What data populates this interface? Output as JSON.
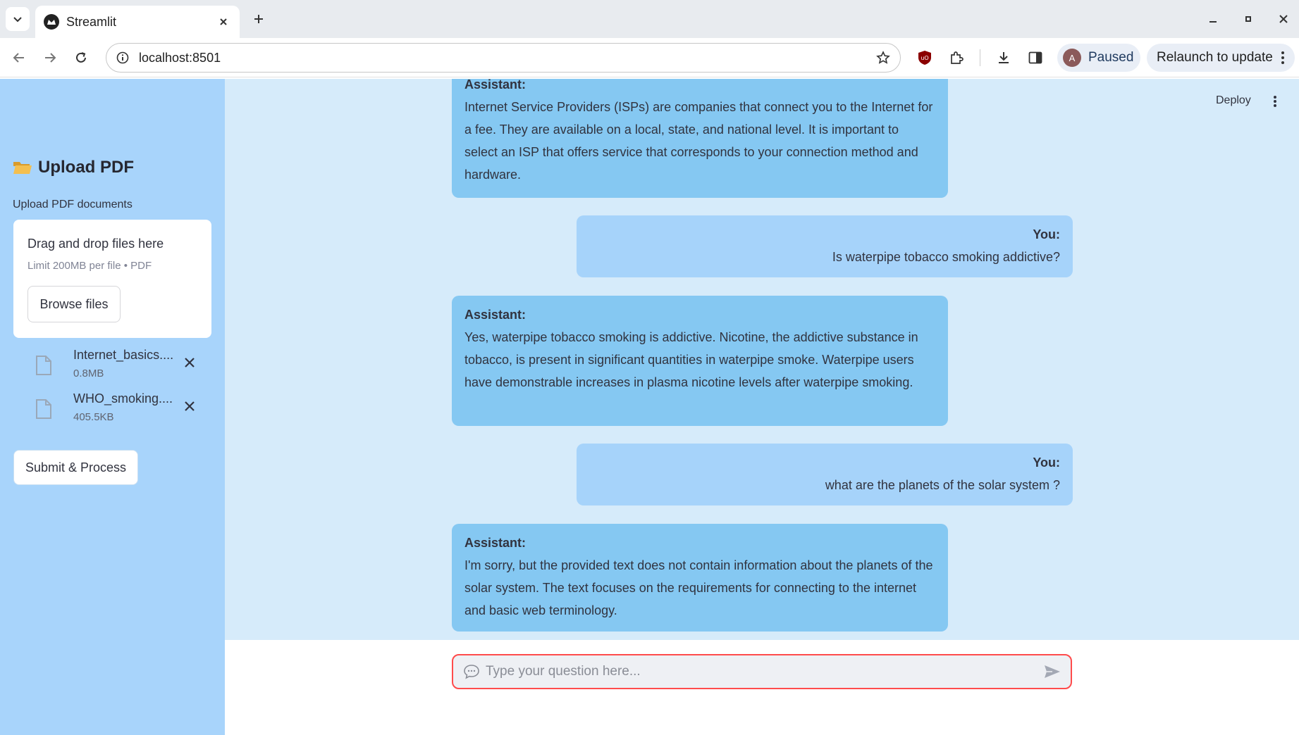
{
  "browser": {
    "tab_title": "Streamlit",
    "url": "localhost:8501",
    "profile_initial": "A",
    "profile_status": "Paused",
    "relaunch_label": "Relaunch to update"
  },
  "sidebar": {
    "title": "Upload PDF",
    "caption": "Upload PDF documents",
    "dropzone_title": "Drag and drop files here",
    "dropzone_limit": "Limit 200MB per file • PDF",
    "browse_label": "Browse files",
    "files": [
      {
        "name": "Internet_basics....",
        "size": "0.8MB"
      },
      {
        "name": "WHO_smoking....",
        "size": "405.5KB"
      }
    ],
    "submit_label": "Submit & Process"
  },
  "header": {
    "deploy_label": "Deploy"
  },
  "chat": {
    "messages": [
      {
        "role": "Assistant:",
        "text": "Internet Service Providers (ISPs) are companies that connect you to the Internet for a fee. They are available on a local, state, and national level. It is important to select an ISP that offers service that corresponds to your connection method and hardware."
      },
      {
        "role": "You:",
        "text": "Is waterpipe tobacco smoking addictive?"
      },
      {
        "role": "Assistant:",
        "text": "Yes, waterpipe tobacco smoking is addictive. Nicotine, the addictive substance in tobacco, is present in significant quantities in waterpipe smoke. Waterpipe users have demonstrable increases in plasma nicotine levels after waterpipe smoking."
      },
      {
        "role": "You:",
        "text": "what are the planets of the solar system ?"
      },
      {
        "role": "Assistant:",
        "text": "I'm sorry, but the provided text does not contain information about the planets of the solar system. The text focuses on the requirements for connecting to the internet and basic web terminology."
      }
    ],
    "input_placeholder": "Type your question here..."
  },
  "colors": {
    "sidebar_bg": "#a8d4fb",
    "main_bg": "#d6ebfa",
    "assistant_bubble": "#85c8f2",
    "user_bubble": "#a6d3fa",
    "accent": "#ff4b4b"
  }
}
